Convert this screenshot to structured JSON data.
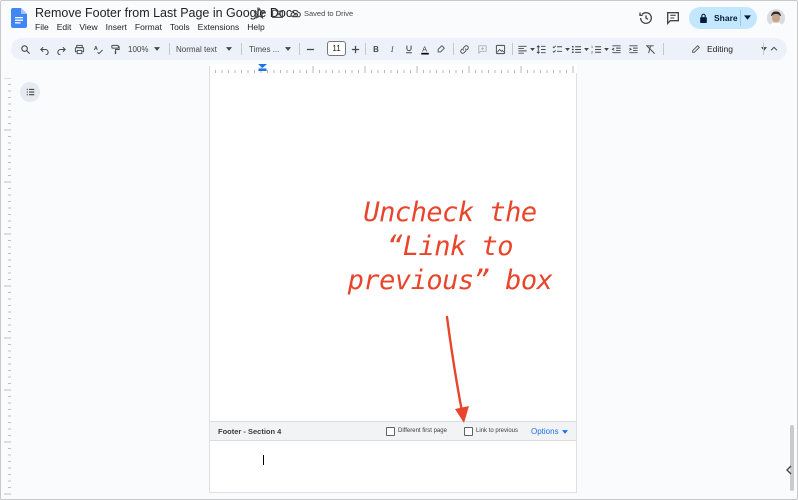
{
  "header": {
    "title": "Remove Footer from Last Page in Google Docs",
    "saved_status": "Saved to Drive",
    "share_label": "Share"
  },
  "menu": [
    "File",
    "Edit",
    "View",
    "Insert",
    "Format",
    "Tools",
    "Extensions",
    "Help"
  ],
  "toolbar": {
    "zoom": "100%",
    "style": "Normal text",
    "font": "Times ...",
    "font_size": "11",
    "mode": "Editing"
  },
  "footer": {
    "section_label": "Footer - Section 4",
    "different_first_page": "Different first page",
    "link_to_previous": "Link to previous",
    "options": "Options"
  },
  "annotation": {
    "lines": [
      "Uncheck the",
      "“Link to",
      "previous” box"
    ]
  },
  "colors": {
    "accent": "#1a73e8",
    "share_bg": "#c2e7ff",
    "annotation": "#e8452c",
    "toolbar_bg": "#edf2fa"
  }
}
